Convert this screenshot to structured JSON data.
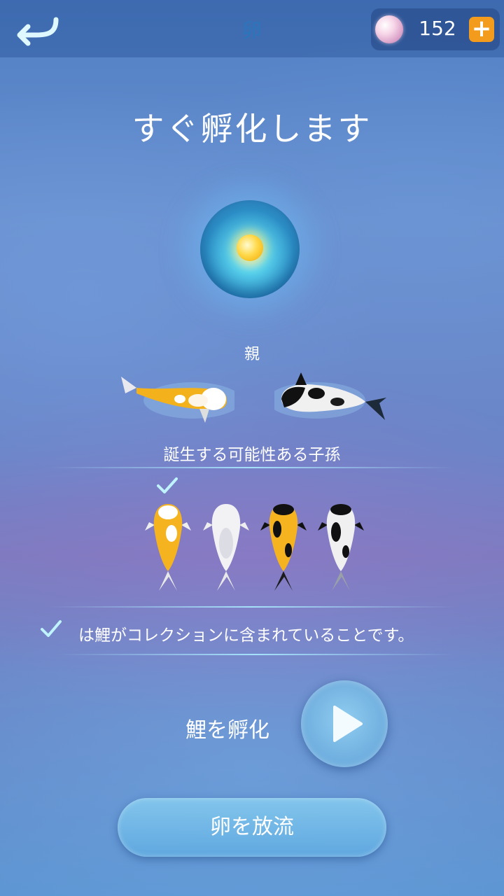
{
  "header": {
    "title": "卵",
    "back_icon": "back-arrow-icon"
  },
  "currency": {
    "icon": "pearl-icon",
    "count": "152",
    "add_label": "+"
  },
  "heading": "すぐ孵化します",
  "egg": {
    "icon": "egg-icon"
  },
  "parents": {
    "label": "親",
    "fish": [
      "gold-koi",
      "black-white-koi"
    ]
  },
  "offspring": {
    "label": "誕生する可能性ある子孫",
    "fish": [
      {
        "name": "gold-white-koi",
        "collected": true
      },
      {
        "name": "white-koi",
        "collected": false
      },
      {
        "name": "black-gold-koi",
        "collected": false
      },
      {
        "name": "black-white-koi",
        "collected": false
      }
    ]
  },
  "note": {
    "icon": "check-icon",
    "text": "は鯉がコレクションに含まれていることです。"
  },
  "actions": {
    "hatch_label": "鯉を孵化",
    "hatch_icon": "play-icon",
    "release_label": "卵を放流"
  },
  "colors": {
    "accent_orange": "#f39b1c",
    "check_cyan": "#aef0ff",
    "divider": "#aaeeff"
  }
}
